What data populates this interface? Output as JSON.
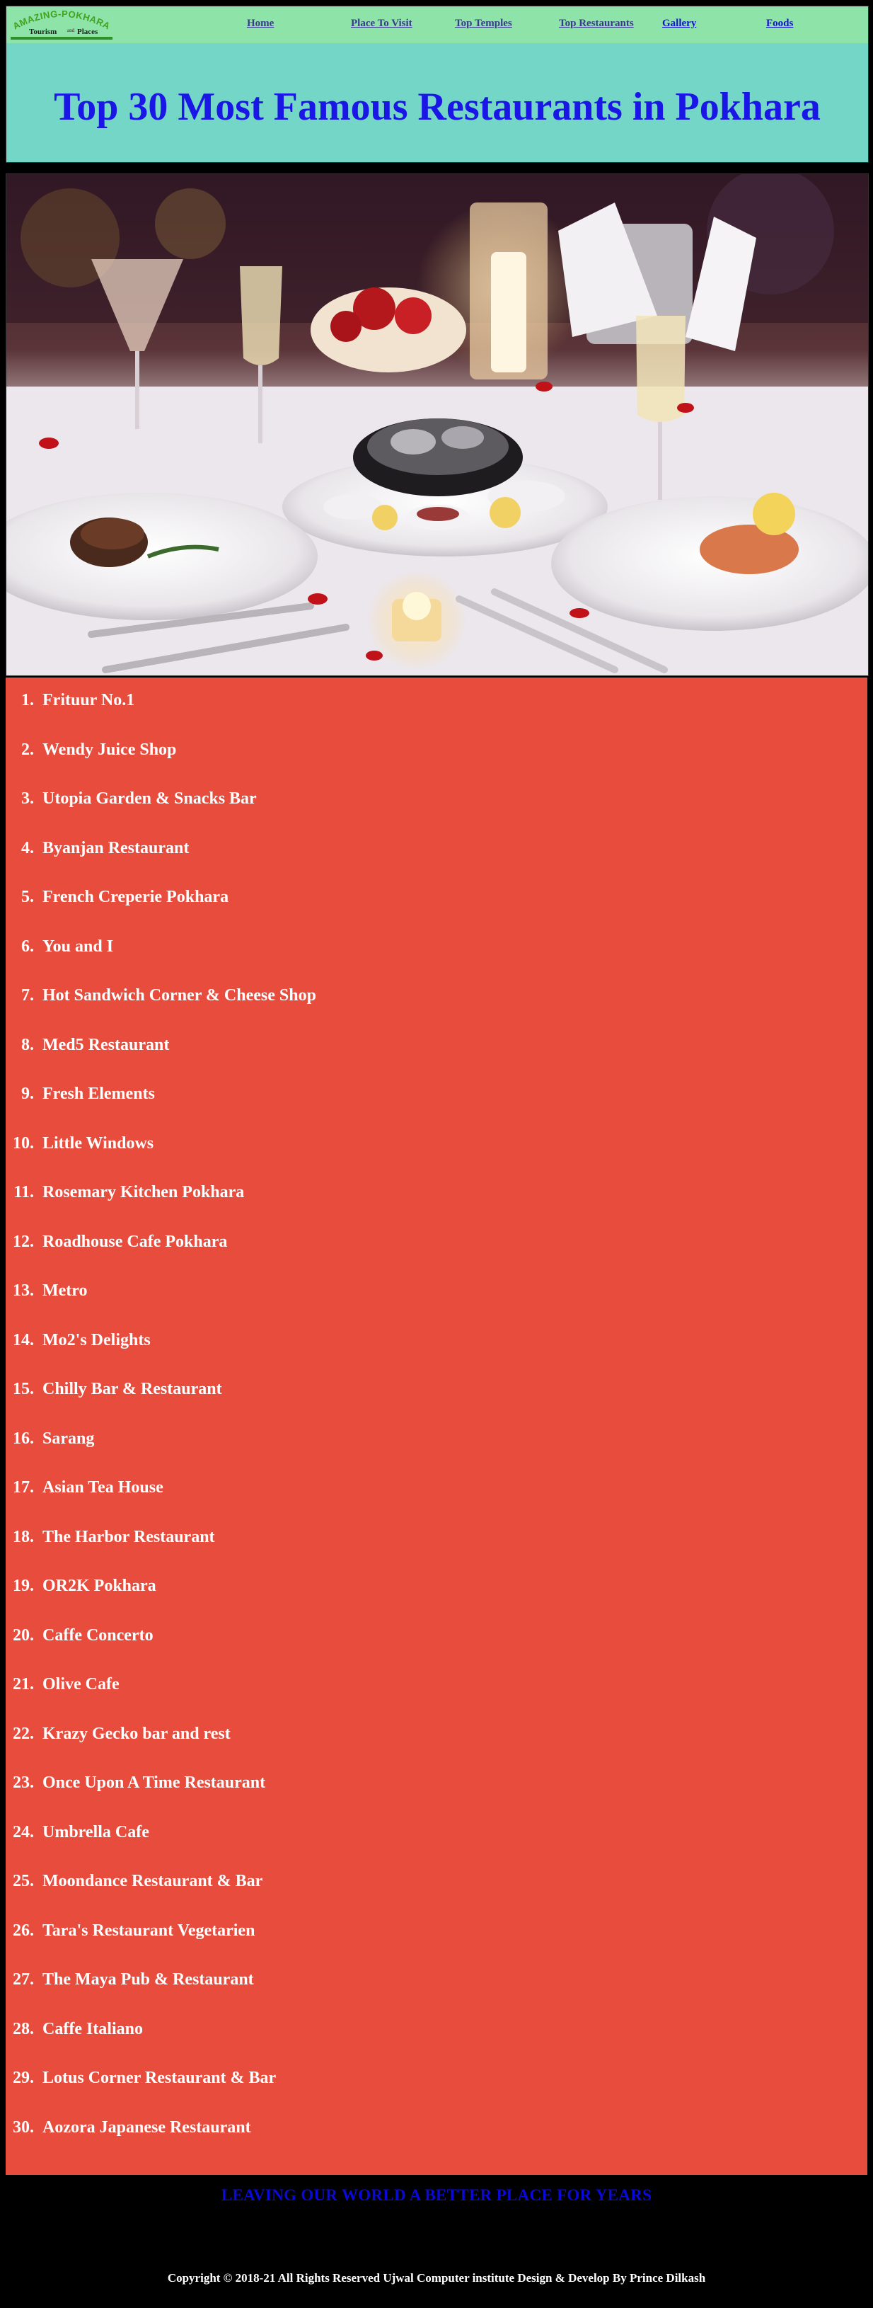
{
  "header": {
    "logo": {
      "top_text": "AMAZING-POKHARA",
      "bottom_text_1": "Tourism",
      "bottom_text_2": "Places"
    },
    "nav": [
      {
        "label": "Home",
        "color": "#3a3a8a"
      },
      {
        "label": "Place To Visit",
        "color": "#3a3a8a"
      },
      {
        "label": "Top Temples",
        "color": "#3a3a8a"
      },
      {
        "label": "Top Restaurants",
        "color": "#3a3a8a"
      },
      {
        "label": "Gallery",
        "color": "#1414c8"
      },
      {
        "label": "Foods",
        "color": "#1414c8"
      }
    ],
    "title": "Top 30 Most Famous Restaurants in Pokhara"
  },
  "restaurants": [
    "Frituur No.1",
    "Wendy Juice Shop",
    "Utopia Garden & Snacks Bar",
    "Byanjan Restaurant",
    "French Creperie Pokhara",
    "You and I",
    "Hot Sandwich Corner & Cheese Shop",
    "Med5 Restaurant",
    "Fresh Elements",
    "Little Windows",
    "Rosemary Kitchen Pokhara",
    "Roadhouse Cafe Pokhara",
    "Metro",
    "Mo2's Delights",
    "Chilly Bar & Restaurant",
    "Sarang",
    "Asian Tea House",
    "The Harbor Restaurant",
    "OR2K Pokhara",
    "Caffe Concerto",
    "Olive Cafe",
    "Krazy Gecko bar and rest",
    "Once Upon A Time Restaurant",
    "Umbrella Cafe",
    "Moondance Restaurant & Bar",
    "Tara's Restaurant Vegetarien",
    "The Maya Pub & Restaurant",
    "Caffe Italiano",
    "Lotus Corner Restaurant & Bar",
    "Aozora Japanese Restaurant"
  ],
  "footer": {
    "tagline": "LEAVING OUR WORLD A BETTER PLACE FOR YEARS",
    "copyright": "Copyright © 2018-21 All Rights Reserved Ujwal Computer institute Design & Develop By Prince Dilkash"
  },
  "colors": {
    "navbar": "#8ee4a8",
    "header": "#74d6c6",
    "title": "#1a17e6",
    "list_panel": "#e84c3d",
    "tagline": "#0a0ad8"
  }
}
